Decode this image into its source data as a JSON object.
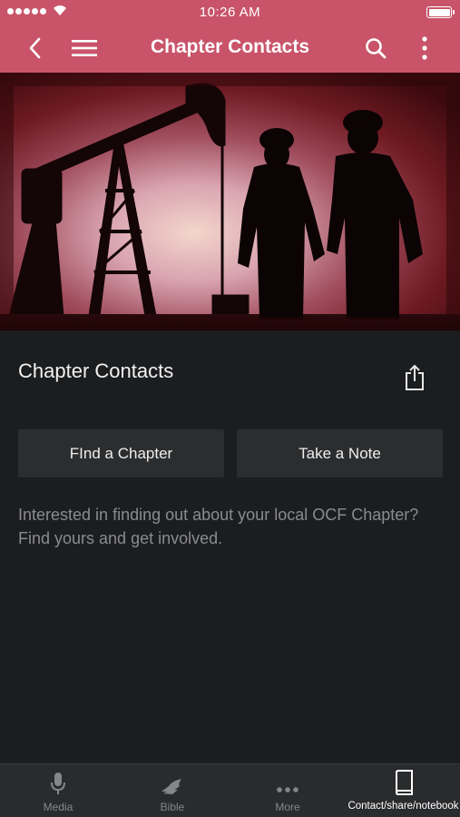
{
  "status_bar": {
    "time": "10:26 AM"
  },
  "nav": {
    "title": "Chapter Contacts",
    "icons": [
      "back-chevron-icon",
      "hamburger-menu-icon",
      "search-icon",
      "more-vertical-icon"
    ]
  },
  "hero": {
    "image": "oil-pumpjack-workers-silhouette"
  },
  "content": {
    "title": "Chapter Contacts",
    "share_icon": "share-icon",
    "buttons": {
      "find_chapter": "FInd a Chapter",
      "take_note": "Take a Note"
    },
    "description": "Interested in finding out about your local OCF Chapter?  Find yours and get involved."
  },
  "tabs": [
    {
      "label": "Media",
      "icon": "microphone-icon",
      "active": false
    },
    {
      "label": "Bible",
      "icon": "praying-hands-icon",
      "active": false
    },
    {
      "label": "More",
      "icon": "more-dots-icon",
      "active": false
    },
    {
      "label": "Contact/share/notebook",
      "icon": "book-icon",
      "active": true
    }
  ],
  "colors": {
    "accent": "#c9546a",
    "background": "#1c1d1f",
    "button_bg": "#2c2d2f",
    "tab_bar_bg": "#2a2b2d",
    "muted_text": "#8a8b8d"
  }
}
